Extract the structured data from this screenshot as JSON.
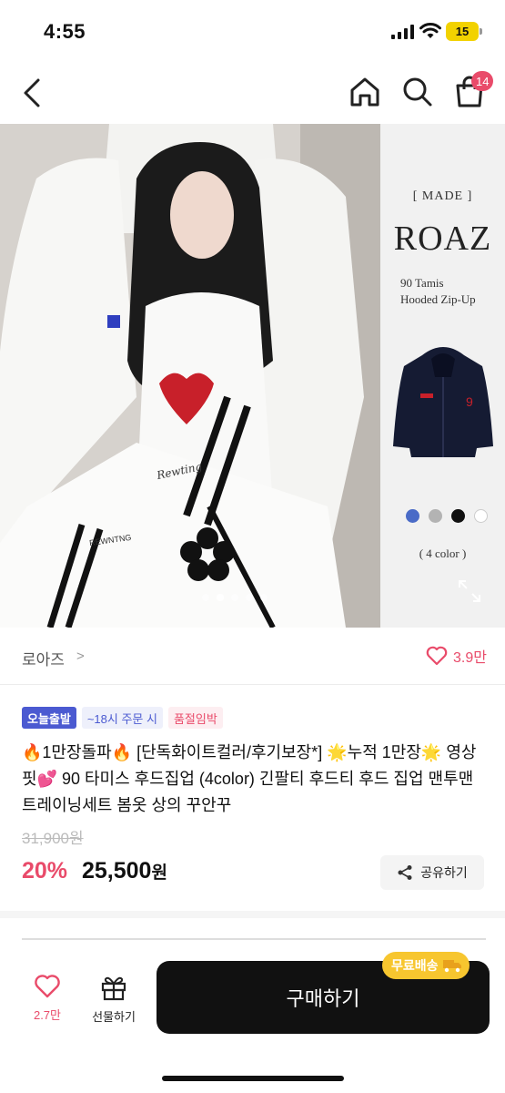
{
  "status_bar": {
    "time": "4:55",
    "battery": "15"
  },
  "header": {
    "cart_count": "14"
  },
  "hero": {
    "side_panel": {
      "made_label": "[ MADE ]",
      "brand": "ROAZ",
      "product_name": "90 Tamis\nHooded Zip-Up",
      "color_count": "( 4 color )",
      "swatches": [
        "#4a6bc7",
        "#b3b3b3",
        "#111111",
        "#ffffff"
      ]
    },
    "photo_text": {
      "embroidery": "Rewting",
      "hood_text": "REWNTNG"
    },
    "slide_count": 5,
    "active_slide": 2
  },
  "brand_row": {
    "brand_name": "로아즈",
    "chevron": ">",
    "likes": "3.9만"
  },
  "badges": {
    "today_ship": "오늘출발",
    "order_cutoff": "~18시 주문 시",
    "low_stock": "품절임박"
  },
  "product": {
    "title": "🔥1만장돌파🔥 [단독화이트컬러/후기보장*] 🌟누적 1만장🌟 영상핏💕 90 타미스 후드집업 (4color) 긴팔티 후드티 후드 집업 맨투맨 트레이닝세트 봄옷 상의 꾸안꾸",
    "original_price": "31,900원",
    "discount": "20%",
    "price": "25,500",
    "price_unit": "원",
    "share_label": "공유하기"
  },
  "bottom_bar": {
    "like_count": "2.7만",
    "gift_label": "선물하기",
    "buy_label": "구매하기",
    "free_shipping": "무료배송"
  },
  "colors": {
    "accent": "#e94b6a",
    "badge_blue": "#4b5ad1",
    "buy_bg": "#111111",
    "free_ship": "#f7c62f"
  }
}
